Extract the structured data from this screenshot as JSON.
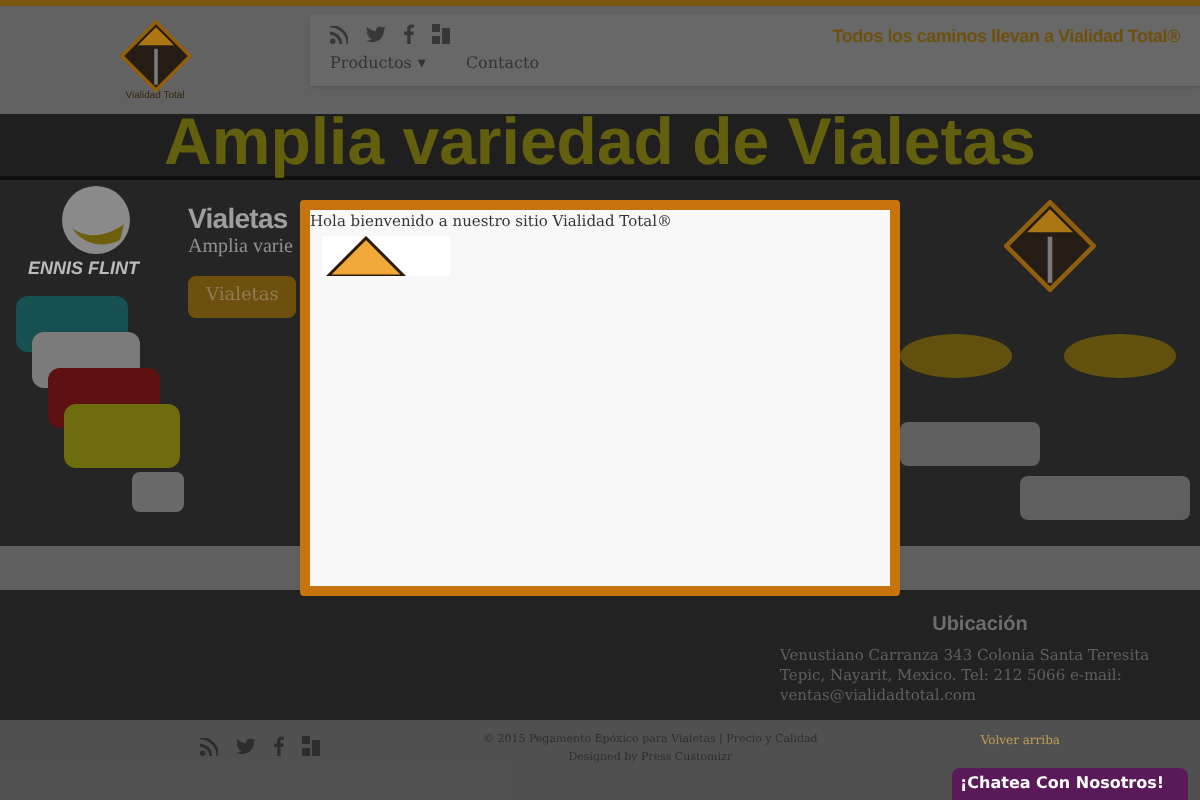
{
  "header": {
    "logo_text": "Vialidad Total",
    "tagline": "Todos los caminos llevan a Vialidad Total®",
    "menu": [
      {
        "label": "Productos",
        "kind": "dropdown",
        "caret": "▾"
      },
      {
        "label": "Contacto",
        "kind": "link"
      }
    ]
  },
  "hero": {
    "title": "Amplia variedad de Vialetas",
    "partner_logo_text": "ENNIS FLINT",
    "slide_title": "Vialetas",
    "slide_text": "Amplia varie",
    "slide_button": "Vialetas"
  },
  "modal": {
    "message": "Hola bienvenido a nuestro sitio Vialidad Total®"
  },
  "footer": {
    "heading": "Ubicación",
    "address": "Venustiano Carranza 343 Colonia Santa Teresita Tepic, Nayarit, Mexico. Tel: 212 5066 e-mail: ventas@vialidadtotal.com"
  },
  "bottom_bar": {
    "copyright": "© 2015 Pegamento Epóxico para Vialetas | Precio y Calidad",
    "credit": "Designed by Press Customizr",
    "back_to_top": "Volver arriba"
  },
  "chat": {
    "label": "¡Chatea Con Nosotros!"
  }
}
